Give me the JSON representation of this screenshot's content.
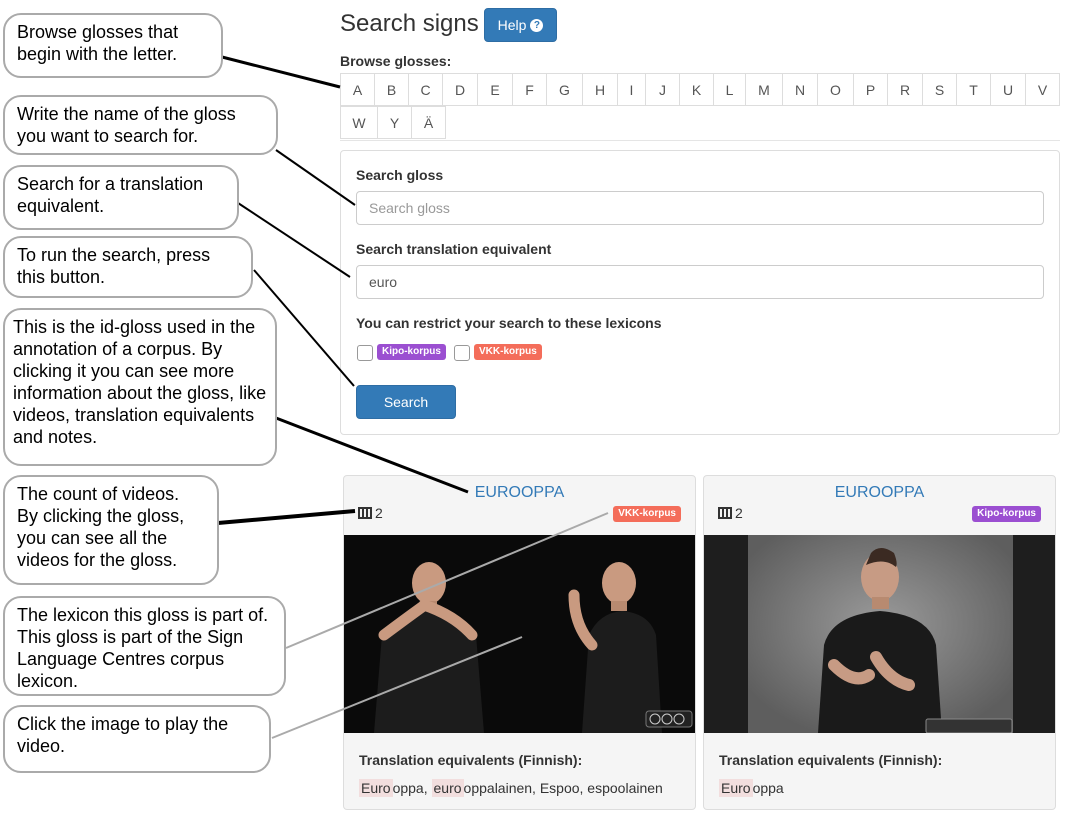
{
  "header": {
    "title": "Search signs",
    "help_label": "Help"
  },
  "browse": {
    "label": "Browse glosses:",
    "row1": [
      "A",
      "B",
      "C",
      "D",
      "E",
      "F",
      "G",
      "H",
      "I",
      "J",
      "K",
      "L",
      "M",
      "N",
      "O",
      "P",
      "R",
      "S",
      "T",
      "U",
      "V"
    ],
    "row2": [
      "W",
      "Y",
      "Ä"
    ]
  },
  "search": {
    "gloss_label": "Search gloss",
    "gloss_placeholder": "Search gloss",
    "gloss_value": "",
    "translation_label": "Search translation equivalent",
    "translation_value": "euro",
    "restrict_label": "You can restrict your search to these lexicons",
    "lexicons": [
      {
        "name": "Kipo-korpus",
        "color": "#9b4fd1"
      },
      {
        "name": "VKK-korpus",
        "color": "#f46d5a"
      }
    ],
    "button_label": "Search"
  },
  "results": [
    {
      "gloss": "EUROOPPA",
      "video_count": "2",
      "lexicon": "VKK-korpus",
      "te_label": "Translation equivalents (Finnish):",
      "te_parts": [
        {
          "hl": "Euro",
          "rest": "oppa,"
        },
        {
          "hl": "euro",
          "rest": "oppalainen, Espoo, espoolainen"
        }
      ]
    },
    {
      "gloss": "EUROOPPA",
      "video_count": "2",
      "lexicon": "Kipo-korpus",
      "te_label": "Translation equivalents (Finnish):",
      "te_parts": [
        {
          "hl": "Euro",
          "rest": "oppa"
        }
      ]
    }
  ],
  "callouts": [
    {
      "text": "Browse glosses that begin with the letter."
    },
    {
      "text": "Write the name of the gloss you want to search for."
    },
    {
      "text": "Search for a translation equivalent."
    },
    {
      "text": "To run the search, press this button."
    },
    {
      "text": "This is the id-gloss used in the annotation of a corpus. By clicking it you can see more information about the gloss, like videos, translation equivalents and notes."
    },
    {
      "text": "The count of videos. By clicking the gloss, you can see all the videos for the gloss."
    },
    {
      "text": "The lexicon this gloss is part of. This gloss is part of the Sign Language Centres corpus lexicon."
    },
    {
      "text": "Click the image to play the video."
    }
  ]
}
